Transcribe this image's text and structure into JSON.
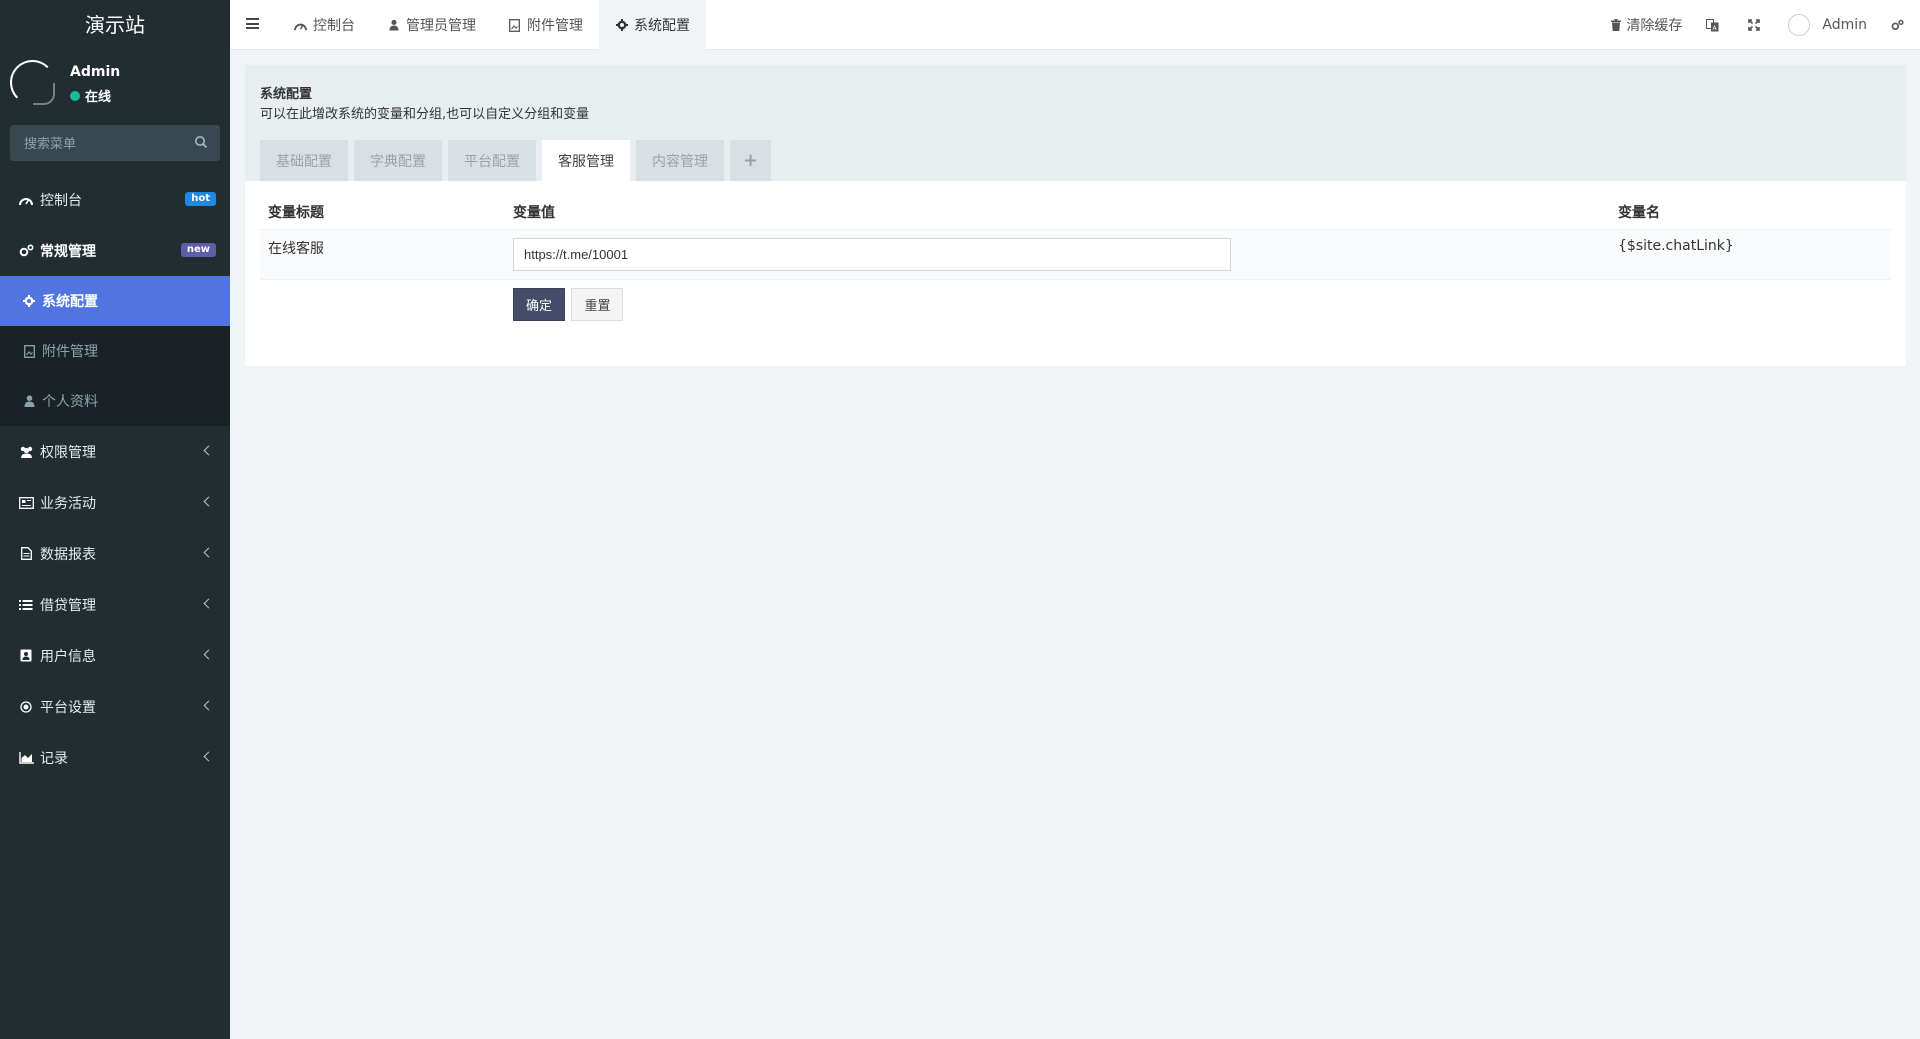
{
  "sidebar": {
    "logo": "演示站",
    "user": {
      "name": "Admin",
      "status": "在线"
    },
    "search": {
      "placeholder": "搜索菜单"
    },
    "items": [
      {
        "label": "控制台",
        "badge": "hot"
      },
      {
        "label": "常规管理",
        "badge": "new"
      },
      {
        "label": "权限管理"
      },
      {
        "label": "业务活动"
      },
      {
        "label": "数据报表"
      },
      {
        "label": "借贷管理"
      },
      {
        "label": "用户信息"
      },
      {
        "label": "平台设置"
      },
      {
        "label": "记录"
      }
    ],
    "submenu": [
      {
        "label": "系统配置"
      },
      {
        "label": "附件管理"
      },
      {
        "label": "个人资料"
      }
    ]
  },
  "topbar": {
    "tabs": [
      {
        "label": "控制台"
      },
      {
        "label": "管理员管理"
      },
      {
        "label": "附件管理"
      },
      {
        "label": "系统配置"
      }
    ],
    "clear_cache": "清除缓存",
    "user": "Admin"
  },
  "panel": {
    "title": "系统配置",
    "description": "可以在此增改系统的变量和分组,也可以自定义分组和变量",
    "tabs": [
      {
        "label": "基础配置"
      },
      {
        "label": "字典配置"
      },
      {
        "label": "平台配置"
      },
      {
        "label": "客服管理"
      },
      {
        "label": "内容管理"
      }
    ],
    "add_tab": "+",
    "table": {
      "headers": [
        "变量标题",
        "变量值",
        "变量名"
      ],
      "rows": [
        {
          "title": "在线客服",
          "value": "https://t.me/10001",
          "name": "{$site.chatLink}"
        }
      ]
    },
    "submit": "确定",
    "reset": "重置"
  },
  "colors": {
    "sidebar_bg": "#222d32",
    "active_menu": "#5074e0",
    "primary_button": "#444c69",
    "online": "#18bc9c"
  }
}
